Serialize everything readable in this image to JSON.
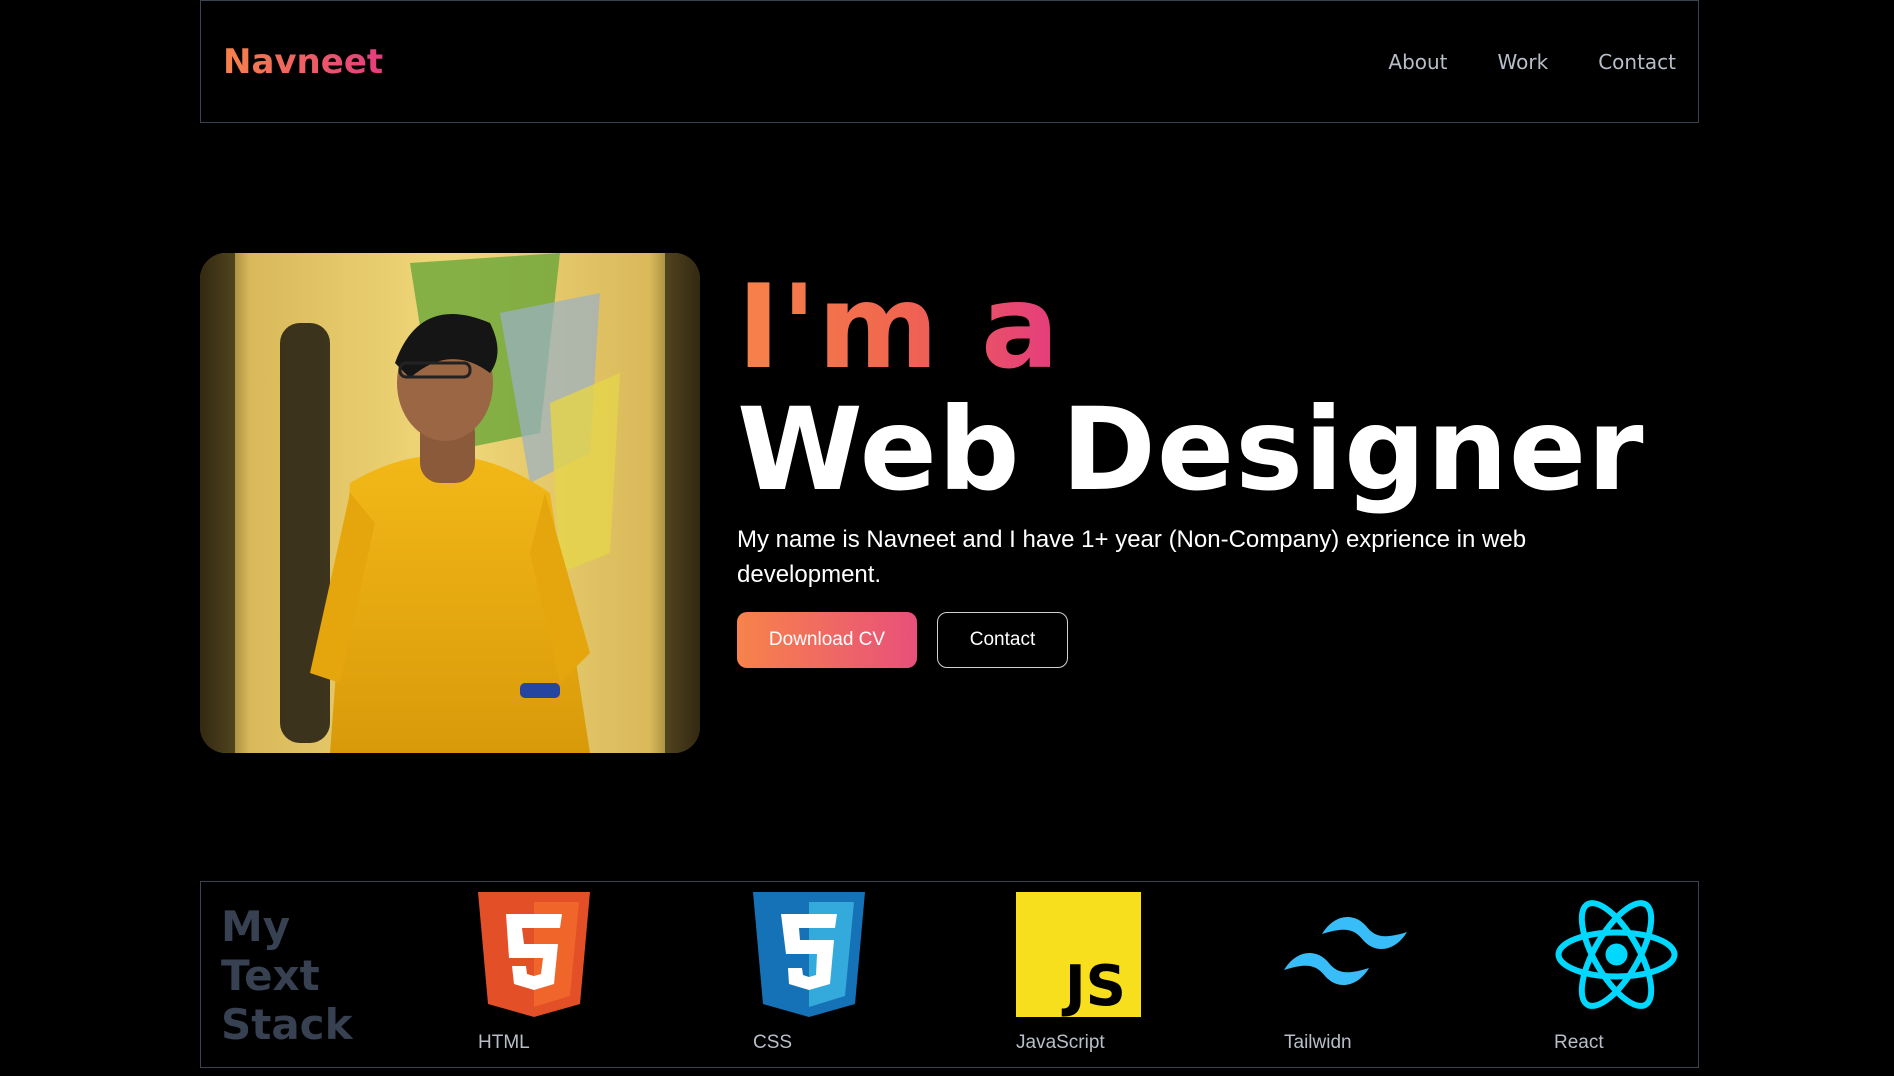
{
  "header": {
    "logo": "Navneet",
    "nav": [
      "About",
      "Work",
      "Contact"
    ]
  },
  "hero": {
    "line1": "I'm a",
    "line2": "Web Designer",
    "description": "My name is Navneet and I have 1+ year (Non-Company) exprience in web development.",
    "buttons": {
      "download": "Download CV",
      "contact": "Contact"
    }
  },
  "stack": {
    "title": "My Text Stack",
    "items": [
      {
        "label": "HTML",
        "icon": "html5-icon"
      },
      {
        "label": "CSS",
        "icon": "css3-icon"
      },
      {
        "label": "JavaScript",
        "icon": "javascript-icon"
      },
      {
        "label": "Tailwidn",
        "icon": "tailwind-icon"
      },
      {
        "label": "React",
        "icon": "react-icon"
      }
    ]
  },
  "colors": {
    "gradient_start": "#f7834a",
    "gradient_end": "#e43c7e",
    "border": "#3a4350"
  }
}
